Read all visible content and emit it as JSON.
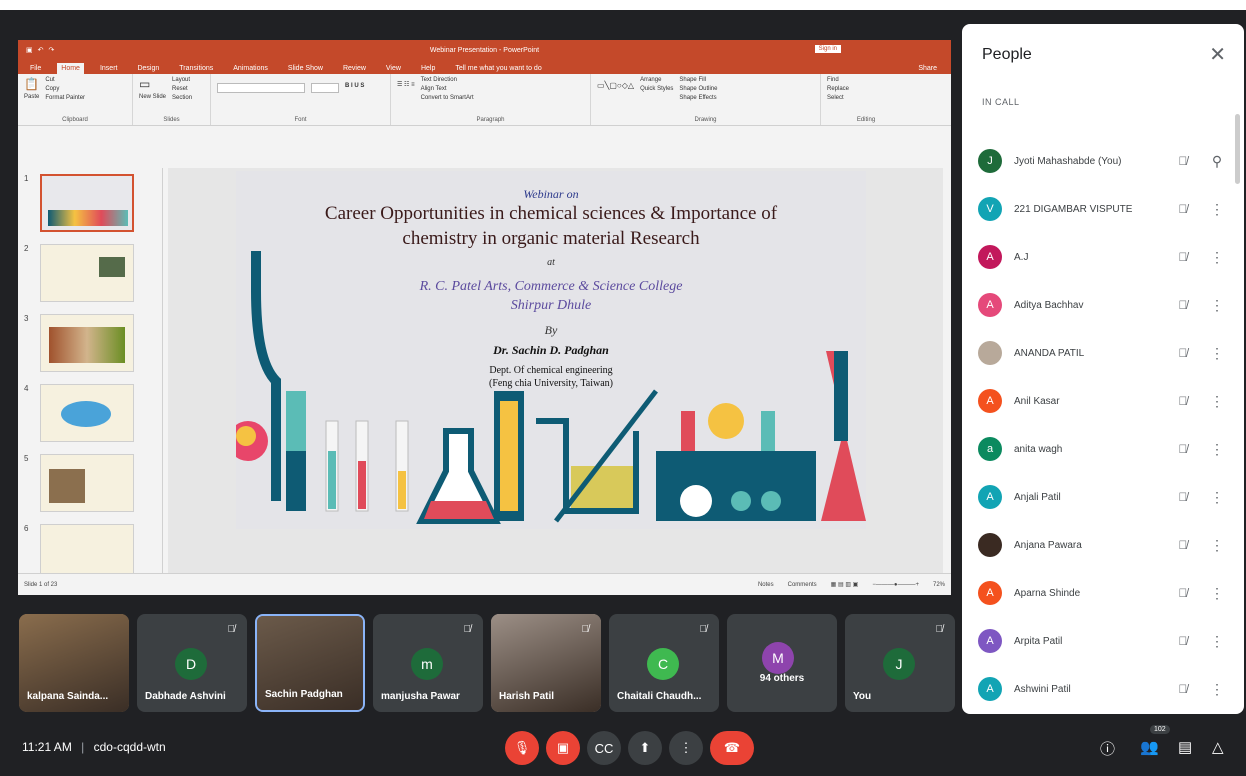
{
  "ppt": {
    "title": "Webinar Presentation - PowerPoint",
    "signin": "Sign in",
    "tabs": [
      "File",
      "Home",
      "Insert",
      "Design",
      "Transitions",
      "Animations",
      "Slide Show",
      "Review",
      "View",
      "Help",
      "Tell me what you want to do"
    ],
    "share": "Share",
    "ribbon": {
      "paste": "Paste",
      "cut": "Cut",
      "copy": "Copy",
      "format_painter": "Format Painter",
      "clipboard": "Clipboard",
      "new_slide": "New Slide",
      "layout": "Layout",
      "reset": "Reset",
      "section": "Section",
      "slides": "Slides",
      "font": "Font",
      "paragraph": "Paragraph",
      "text_direction": "Text Direction",
      "align_text": "Align Text",
      "convert_smartart": "Convert to SmartArt",
      "arrange": "Arrange",
      "quick_styles": "Quick Styles",
      "shape_fill": "Shape Fill",
      "shape_outline": "Shape Outline",
      "shape_effects": "Shape Effects",
      "drawing": "Drawing",
      "find": "Find",
      "replace": "Replace",
      "select": "Select",
      "editing": "Editing"
    },
    "slide_numbers": [
      "1",
      "2",
      "3",
      "4",
      "5",
      "6"
    ],
    "slide": {
      "l1": "Webinar on",
      "l2": "Career Opportunities in  chemical sciences & Importance of",
      "l3": "chemistry in organic material Research",
      "l4": "at",
      "l5": "R. C. Patel Arts, Commerce & Science College",
      "l6": "Shirpur Dhule",
      "l7": "By",
      "l8": "Dr. Sachin D. Padghan",
      "l9": "Dept. Of chemical engineering",
      "l10": "(Feng chia University, Taiwan)"
    },
    "status": {
      "slide_of": "Slide 1 of 23",
      "notes": "Notes",
      "comments": "Comments",
      "zoom": "72%"
    }
  },
  "people": {
    "title": "People",
    "section": "IN CALL",
    "list": [
      {
        "initial": "J",
        "name": "Jyoti Mahashabde (You)",
        "color": "#1e6b3a",
        "action": "pin-icon"
      },
      {
        "initial": "V",
        "name": "221 DIGAMBAR VISPUTE",
        "color": "#12a4b4",
        "action": "more-icon"
      },
      {
        "initial": "A",
        "name": "A.J",
        "color": "#c2185b",
        "action": "more-icon"
      },
      {
        "initial": "A",
        "name": "Aditya Bachhav",
        "color": "#e5497a",
        "action": "more-icon"
      },
      {
        "initial": "",
        "name": "ANANDA PATIL",
        "color": "#b8a99a",
        "action": "more-icon"
      },
      {
        "initial": "A",
        "name": "Anil Kasar",
        "color": "#f4511e",
        "action": "more-icon"
      },
      {
        "initial": "a",
        "name": "anita wagh",
        "color": "#0b8a5f",
        "action": "more-icon"
      },
      {
        "initial": "A",
        "name": "Anjali Patil",
        "color": "#12a4b4",
        "action": "more-icon"
      },
      {
        "initial": "",
        "name": "Anjana Pawara",
        "color": "#3a2a22",
        "action": "more-icon"
      },
      {
        "initial": "A",
        "name": "Aparna Shinde",
        "color": "#f4511e",
        "action": "more-icon"
      },
      {
        "initial": "A",
        "name": "Arpita Patil",
        "color": "#7e57c2",
        "action": "more-icon"
      },
      {
        "initial": "A",
        "name": "Ashwini Patil",
        "color": "#12a4b4",
        "action": "more-icon"
      }
    ]
  },
  "tiles": [
    {
      "name": "kalpana Sainda...",
      "initial": "",
      "color": "#8a6d4d",
      "photo": true,
      "muted": false
    },
    {
      "name": "Dabhade Ashvini",
      "initial": "D",
      "color": "#1e6b3a",
      "photo": false,
      "muted": true
    },
    {
      "name": "Sachin Padghan",
      "initial": "",
      "color": "#6b5a4a",
      "photo": true,
      "muted": false
    },
    {
      "name": "manjusha Pawar",
      "initial": "m",
      "color": "#1e6b3a",
      "photo": false,
      "muted": true
    },
    {
      "name": "Harish Patil",
      "initial": "",
      "color": "#9c8f86",
      "photo": true,
      "muted": true
    },
    {
      "name": "Chaitali Chaudh...",
      "initial": "C",
      "color": "#3fb950",
      "photo": false,
      "muted": true
    },
    {
      "name": "94 others",
      "initial": "M",
      "color": "#8e44ad",
      "photo": false,
      "muted": false
    },
    {
      "name": "You",
      "initial": "J",
      "color": "#1e6b3a",
      "photo": false,
      "muted": true
    }
  ],
  "meeting": {
    "time": "11:21 AM",
    "code": "cdo-cqdd-wtn",
    "people_count": "102"
  }
}
